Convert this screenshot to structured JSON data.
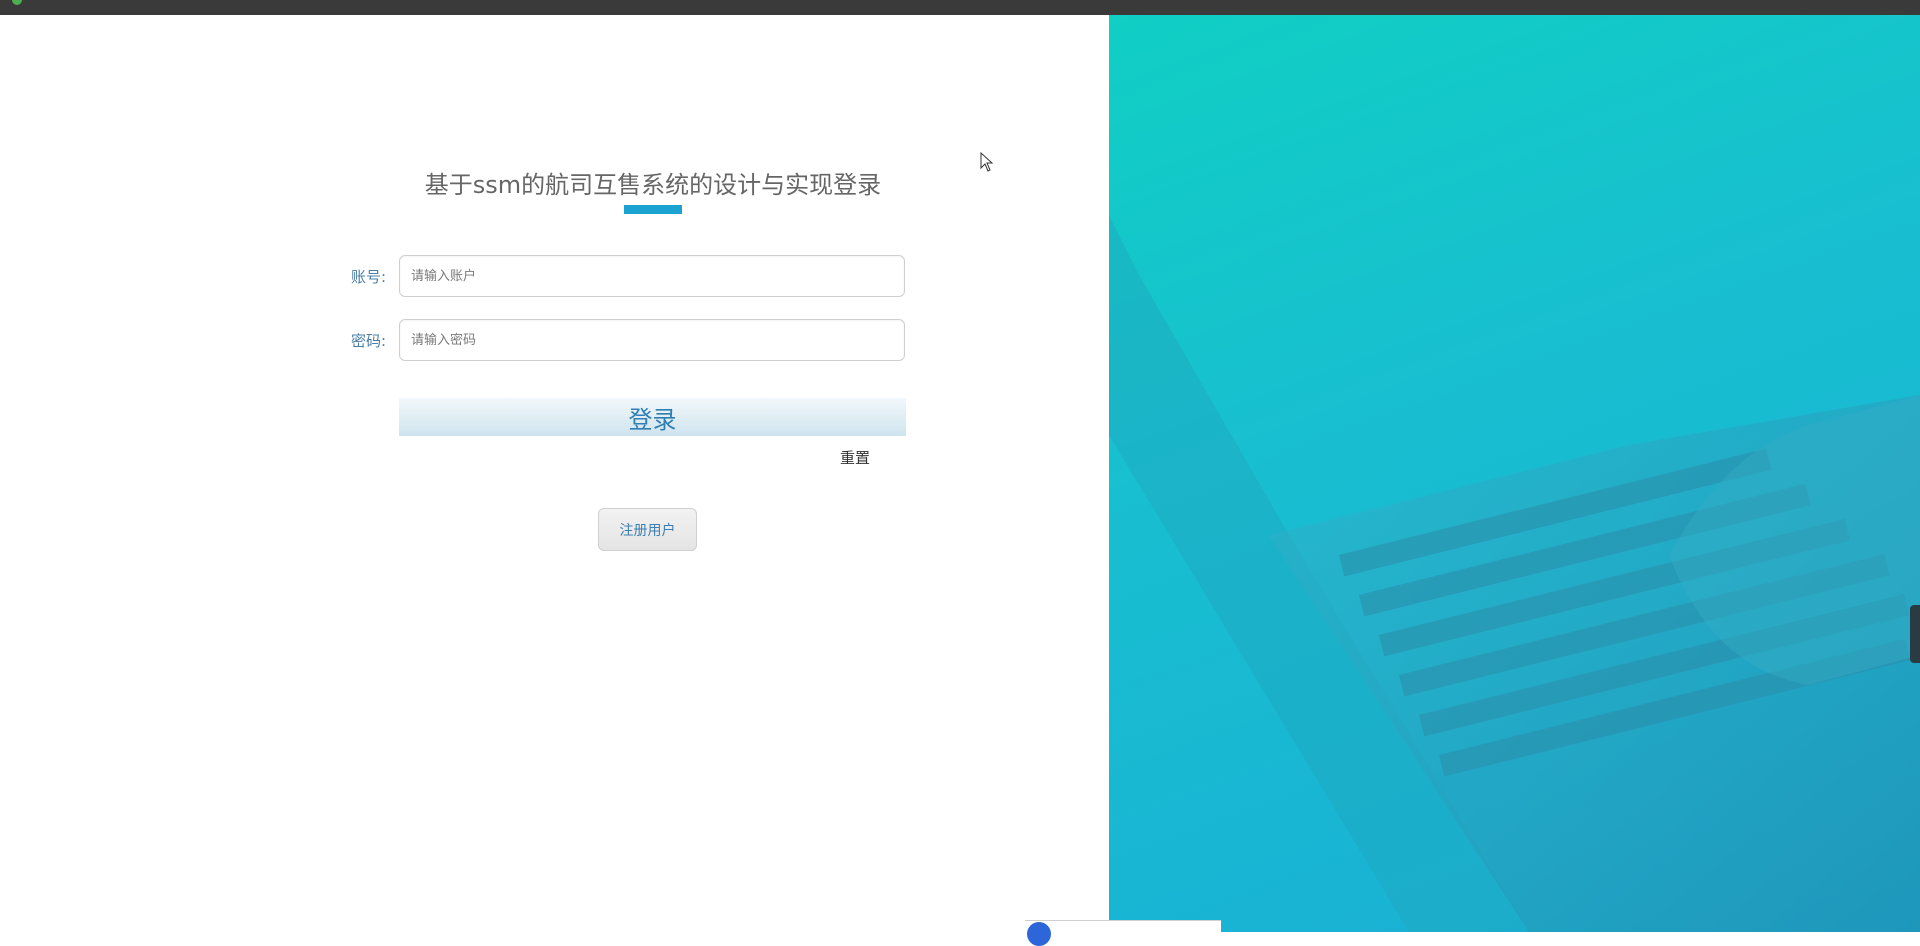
{
  "login": {
    "title": "基于ssm的航司互售系统的设计与实现登录",
    "account_label": "账号:",
    "account_placeholder": "请输入账户",
    "password_label": "密码:",
    "password_placeholder": "请输入密码",
    "login_button": "登录",
    "reset_link": "重置",
    "register_button": "注册用户"
  },
  "colors": {
    "accent": "#1aa3d1",
    "label": "#4a7ea6",
    "right_panel_start": "#10cfc4",
    "right_panel_end": "#1aaed6"
  }
}
